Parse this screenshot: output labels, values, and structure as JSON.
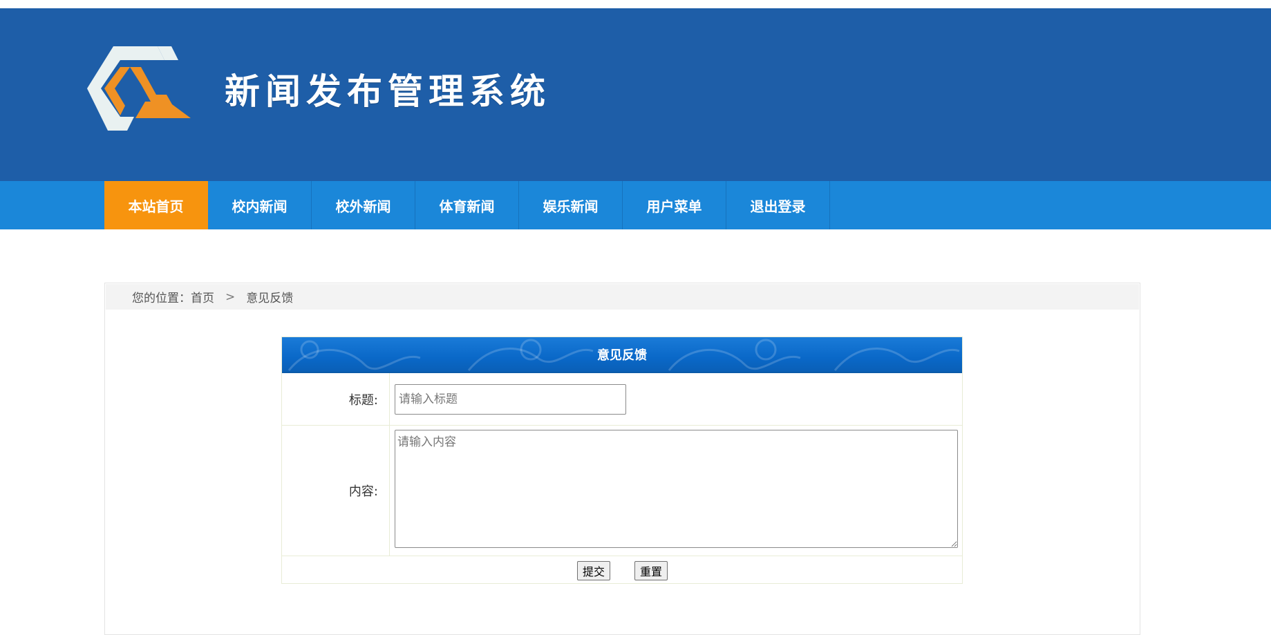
{
  "header": {
    "site_title": "新闻发布管理系统",
    "logo_icon": "logo-mark",
    "colors": {
      "banner": "#1e5ea8",
      "navbar": "#1b87d9",
      "active_nav": "#f7940e",
      "logo_orange": "#ef9124",
      "logo_white": "#e9f1f1"
    }
  },
  "nav": {
    "items": [
      {
        "label": "本站首页",
        "active": true
      },
      {
        "label": "校内新闻",
        "active": false
      },
      {
        "label": "校外新闻",
        "active": false
      },
      {
        "label": "体育新闻",
        "active": false
      },
      {
        "label": "娱乐新闻",
        "active": false
      },
      {
        "label": "用户菜单",
        "active": false
      },
      {
        "label": "退出登录",
        "active": false
      }
    ]
  },
  "breadcrumb": {
    "prefix": "您的位置：首页",
    "separator": ">",
    "current": "意见反馈"
  },
  "form": {
    "heading": "意见反馈",
    "title_label": "标题:",
    "title_placeholder": "请输入标题",
    "title_value": "",
    "content_label": "内容:",
    "content_placeholder": "请输入内容",
    "content_value": "",
    "submit_label": "提交",
    "reset_label": "重置"
  }
}
